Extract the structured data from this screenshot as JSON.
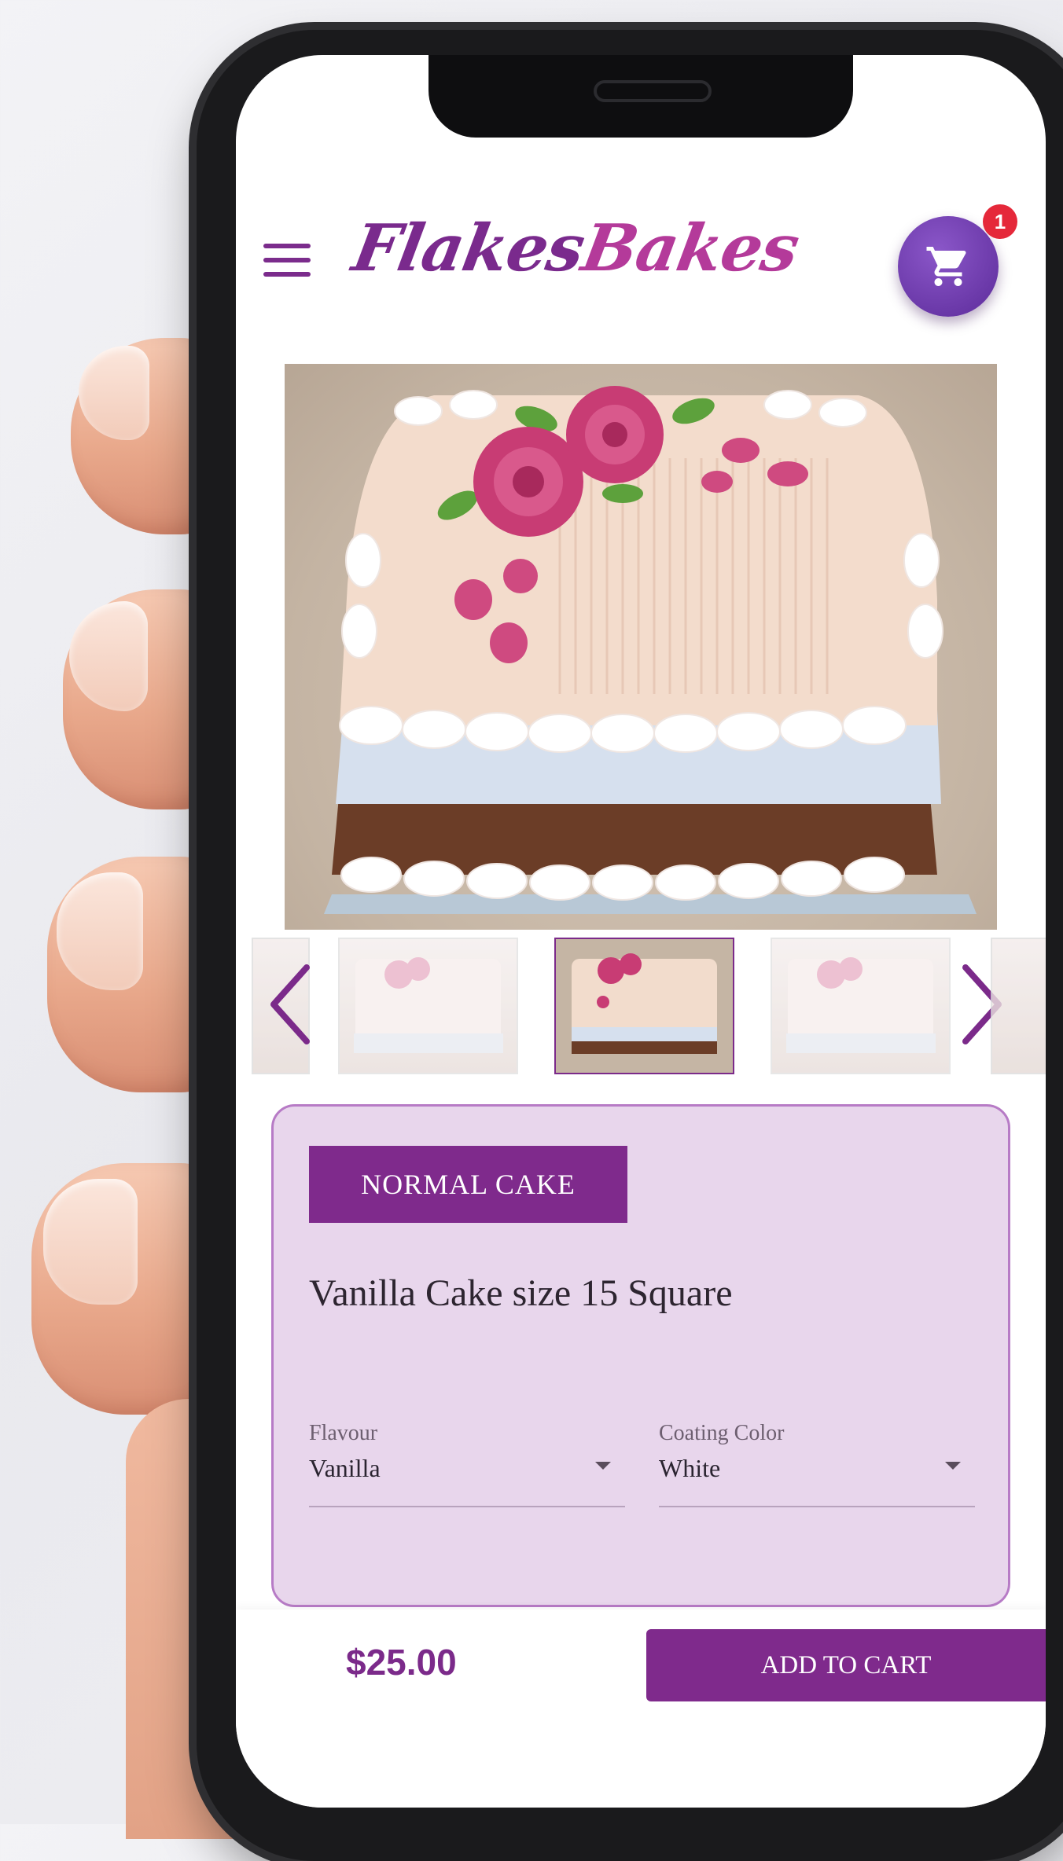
{
  "app": {
    "logo_text_1": "Flakes",
    "logo_text_2": "Bakes"
  },
  "header": {
    "cart_count": "1"
  },
  "product": {
    "category": "NORMAL CAKE",
    "name": "Vanilla Cake size 15 Square",
    "options": [
      {
        "label": "Flavour",
        "value": "Vanilla"
      },
      {
        "label": "Coating Color",
        "value": "White"
      }
    ],
    "price": "$25.00"
  },
  "actions": {
    "add_to_cart": "ADD TO CART"
  },
  "colors": {
    "brand": "#7f2a8c",
    "card_bg": "#e8d6ec",
    "badge": "#e5283a"
  }
}
